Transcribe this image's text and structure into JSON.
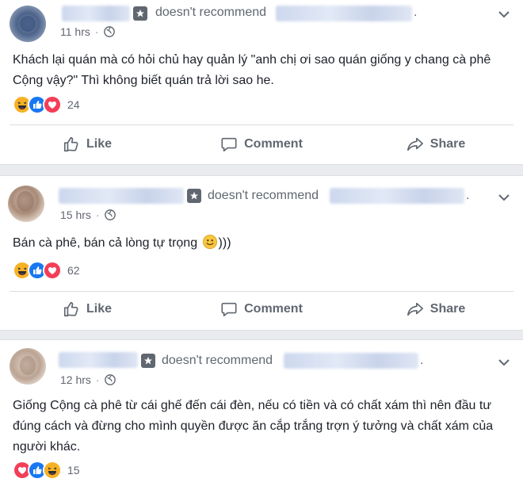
{
  "posts": [
    {
      "recommend_text": "doesn't recommend",
      "time": "11 hrs",
      "body": "Khách lại quán mà có hỏi chủ hay quản lý \"anh chị ơi sao quán giống y chang cà phê Cộng vậy?\" Thì không biết quán trả lời sao he.",
      "reactions": [
        "haha",
        "like",
        "love"
      ],
      "reaction_count": "24"
    },
    {
      "recommend_text": "doesn't recommend",
      "time": "15 hrs",
      "body_before": "Bán cà phê, bán cả lòng tự trọng",
      "body_after": ")))",
      "reactions": [
        "haha",
        "like",
        "love"
      ],
      "reaction_count": "62"
    },
    {
      "recommend_text": "doesn't recommend",
      "time": "12 hrs",
      "body": "Giống Cộng cà phê từ cái ghế đến cái đèn, nếu có tiền và có chất xám thì nên đầu tư đúng cách và đừng cho mình quyền được ăn cắp trắng trợn ý tưởng và chất xám của người khác.",
      "reactions": [
        "love",
        "like",
        "haha"
      ],
      "reaction_count": "15"
    }
  ],
  "actions": {
    "like": "Like",
    "comment": "Comment",
    "share": "Share"
  },
  "colors": {
    "like_blue": "#1877f2",
    "love_red": "#f33e58",
    "haha_yellow": "#f7b125",
    "background": "#e9ebee"
  }
}
